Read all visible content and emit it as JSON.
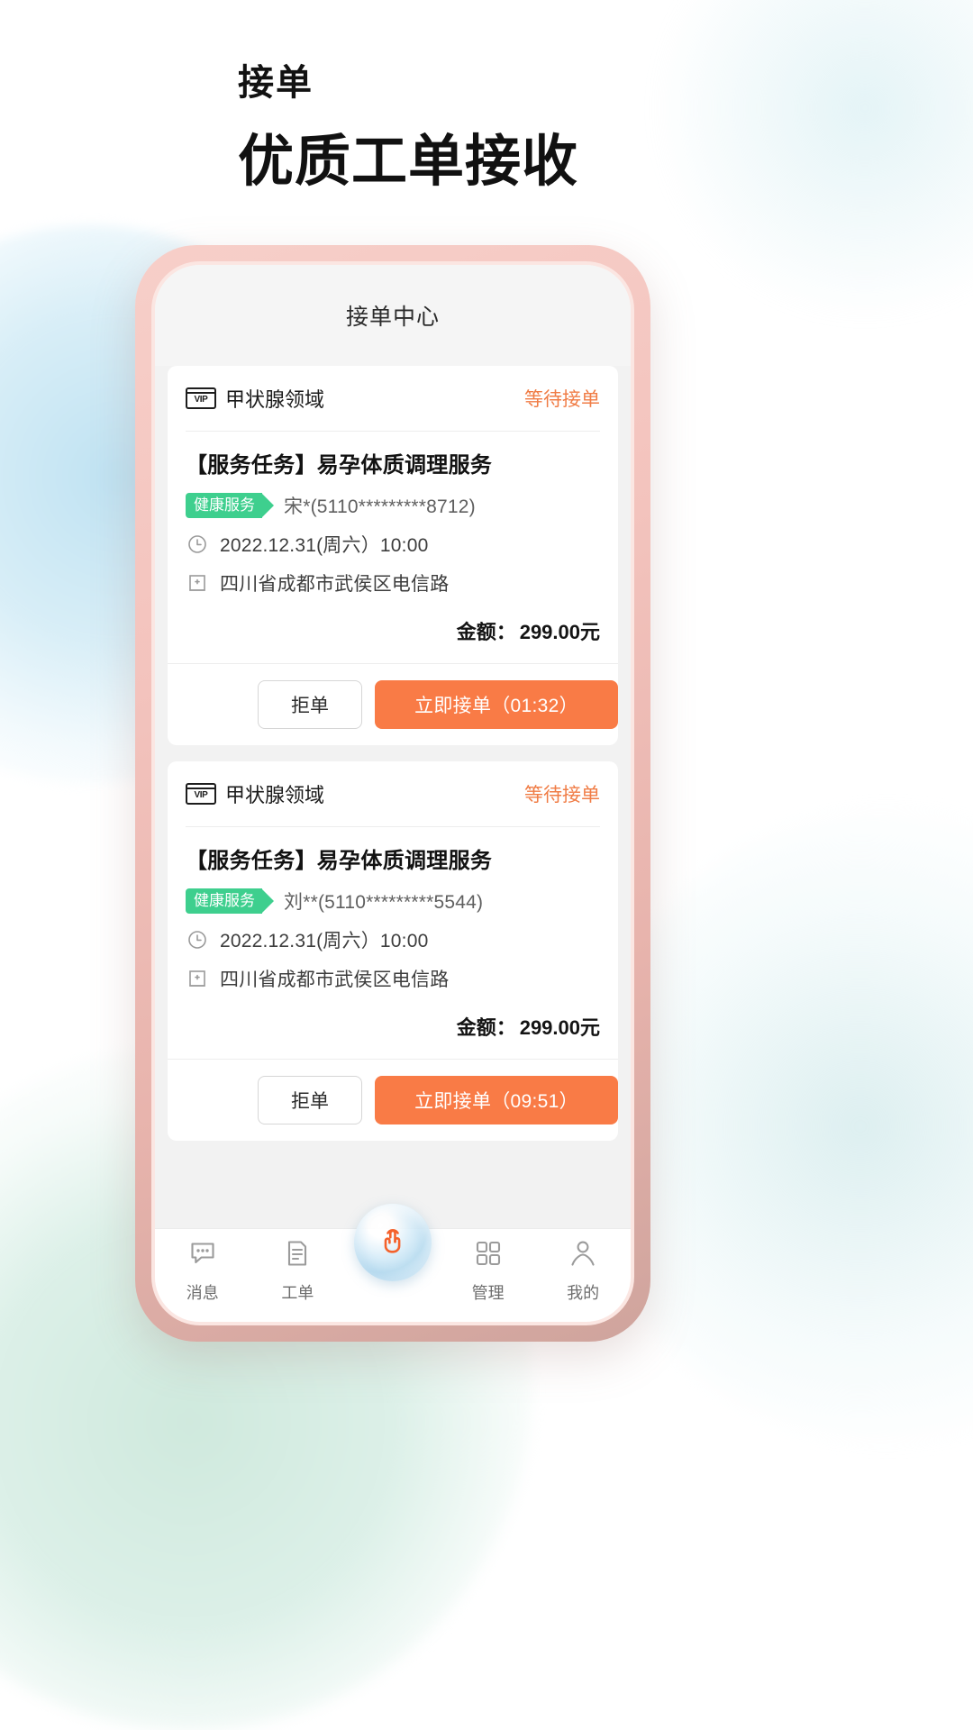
{
  "promo": {
    "kicker": "接单",
    "headline": "优质工单接收"
  },
  "app": {
    "title": "接单中心"
  },
  "orders": [
    {
      "vip_badge": "VIP",
      "category": "甲状腺领域",
      "status": "等待接单",
      "task_title": "【服务任务】易孕体质调理服务",
      "tag": "健康服务",
      "customer": "宋*(5110*********8712)",
      "datetime": "2022.12.31(周六）10:00",
      "address": "四川省成都市武侯区电信路",
      "amount_label": "金额：",
      "amount_value": "299.00元",
      "reject_label": "拒单",
      "accept_label": "立即接单（01:32）"
    },
    {
      "vip_badge": "VIP",
      "category": "甲状腺领域",
      "status": "等待接单",
      "task_title": "【服务任务】易孕体质调理服务",
      "tag": "健康服务",
      "customer": "刘**(5110*********5544)",
      "datetime": "2022.12.31(周六）10:00",
      "address": "四川省成都市武侯区电信路",
      "amount_label": "金额：",
      "amount_value": "299.00元",
      "reject_label": "拒单",
      "accept_label": "立即接单（09:51）"
    }
  ],
  "tabbar": {
    "items": [
      {
        "label": "消息",
        "icon": "chat-bubble-icon"
      },
      {
        "label": "工单",
        "icon": "document-icon"
      },
      {
        "label": "",
        "icon": "tap-finger-icon"
      },
      {
        "label": "管理",
        "icon": "grid-icon"
      },
      {
        "label": "我的",
        "icon": "person-icon"
      }
    ]
  },
  "colors": {
    "accent_orange": "#f97b46",
    "status_orange": "#f07c45",
    "tag_green": "#3ecf8e",
    "phone_frame_pink": "#f3c3bd"
  }
}
